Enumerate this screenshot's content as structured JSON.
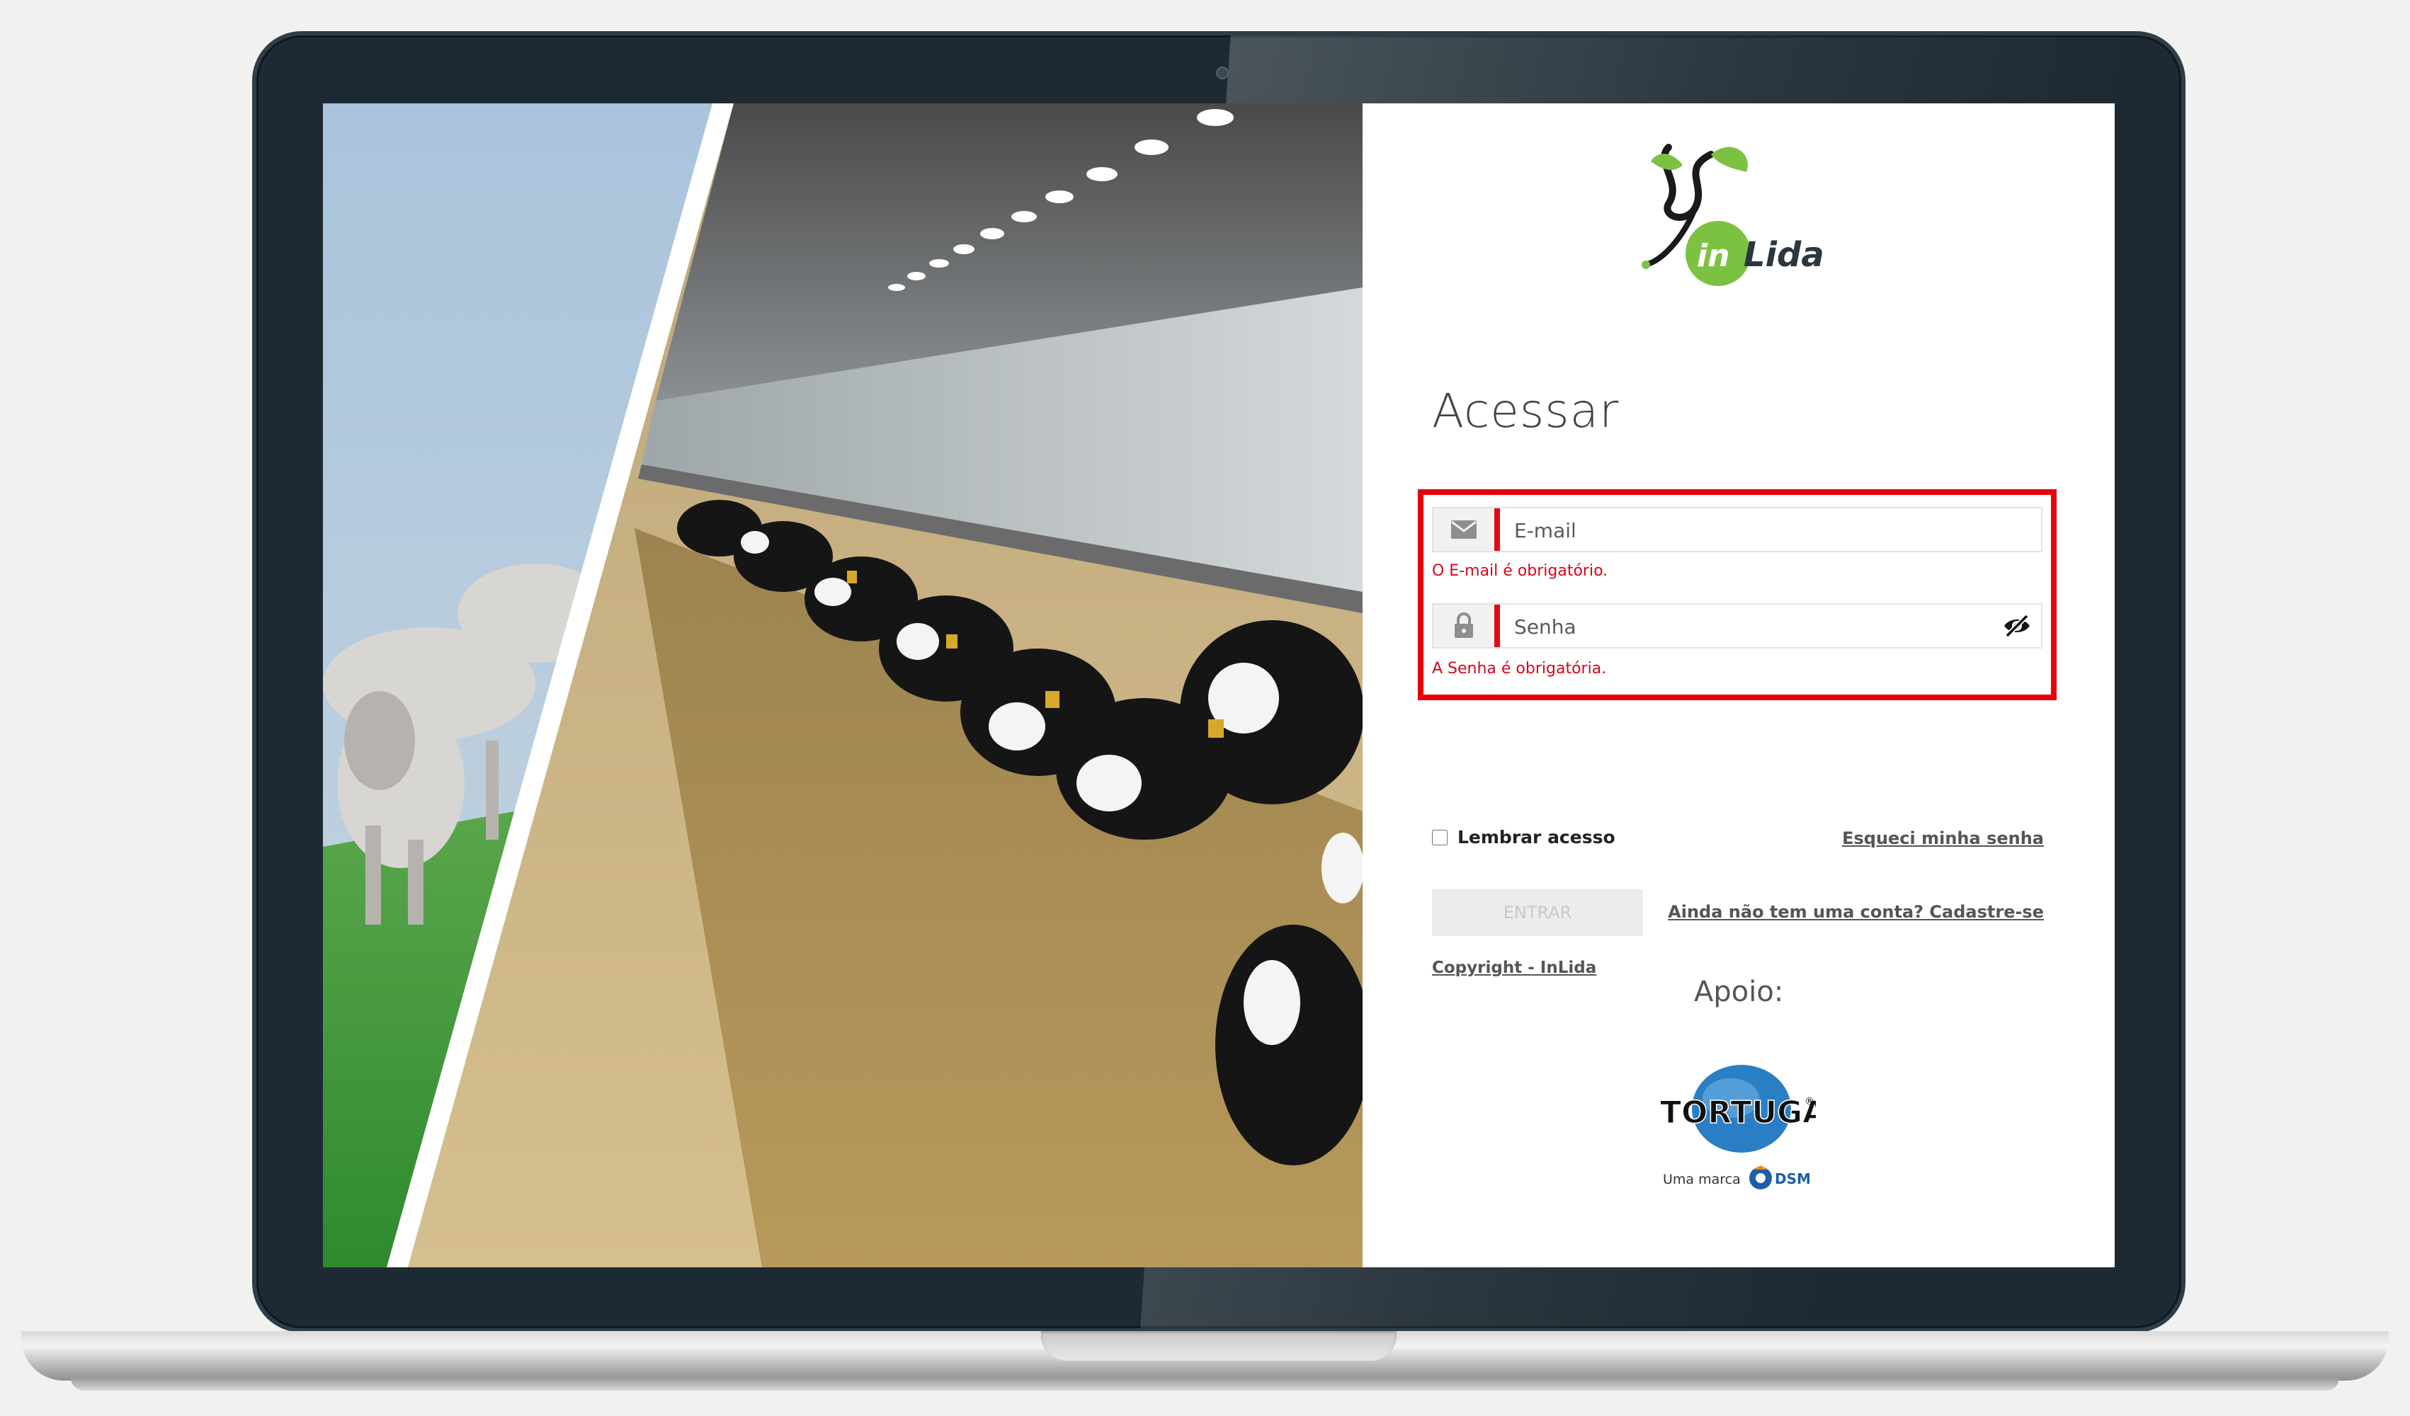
{
  "login": {
    "logo_text": "inLida",
    "title": "Acessar",
    "email": {
      "placeholder": "E-mail",
      "value": "",
      "error": "O E-mail é obrigatório."
    },
    "password": {
      "placeholder": "Senha",
      "value": "",
      "error": "A Senha é obrigatória."
    },
    "remember_label": "Lembrar acesso",
    "forgot_link": "Esqueci minha senha",
    "enter_button": "ENTRAR",
    "signup_link": "Ainda não tem uma conta? Cadastre-se",
    "copyright_link": "Copyright - InLida",
    "support_label": "Apoio:",
    "sponsor": {
      "name": "TORTUGA",
      "tagline": "Uma marca",
      "parent": "DSM"
    }
  },
  "colors": {
    "error_red": "#e8000b",
    "brand_green": "#7cc242",
    "frame": "#1e2a33"
  },
  "icons": [
    "envelope-icon",
    "lock-icon",
    "eye-slash-icon"
  ]
}
